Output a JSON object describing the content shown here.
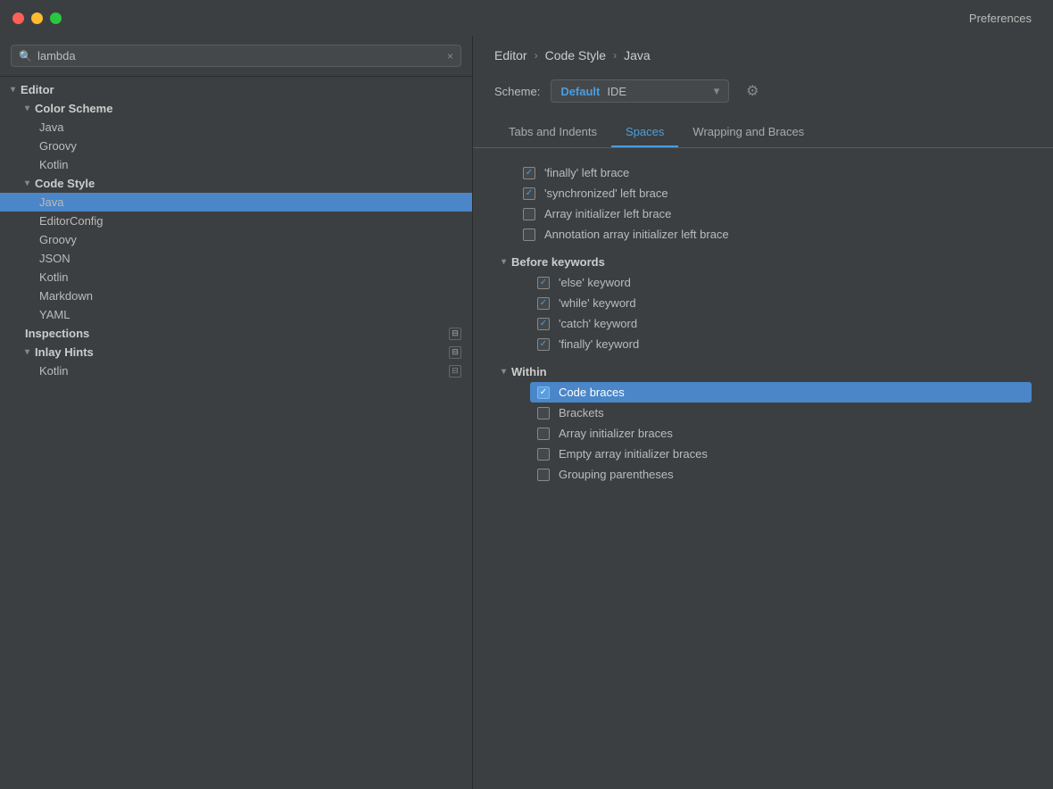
{
  "window": {
    "title": "Preferences"
  },
  "titleBar": {
    "close": "close",
    "minimize": "minimize",
    "maximize": "maximize"
  },
  "sidebar": {
    "searchPlaceholder": "lambda",
    "clearLabel": "×",
    "tree": [
      {
        "id": "editor",
        "label": "Editor",
        "level": 0,
        "chevron": "▾",
        "hasChevron": true,
        "selected": false,
        "badge": false
      },
      {
        "id": "color-scheme",
        "label": "Color Scheme",
        "level": 1,
        "chevron": "▾",
        "hasChevron": true,
        "selected": false,
        "badge": false
      },
      {
        "id": "java-color",
        "label": "Java",
        "level": 2,
        "hasChevron": false,
        "selected": false,
        "badge": false
      },
      {
        "id": "groovy-color",
        "label": "Groovy",
        "level": 2,
        "hasChevron": false,
        "selected": false,
        "badge": false
      },
      {
        "id": "kotlin-color",
        "label": "Kotlin",
        "level": 2,
        "hasChevron": false,
        "selected": false,
        "badge": false
      },
      {
        "id": "code-style",
        "label": "Code Style",
        "level": 1,
        "chevron": "▾",
        "hasChevron": true,
        "selected": false,
        "badge": false
      },
      {
        "id": "java-cs",
        "label": "Java",
        "level": 2,
        "hasChevron": false,
        "selected": true,
        "badge": false
      },
      {
        "id": "editorconfig",
        "label": "EditorConfig",
        "level": 2,
        "hasChevron": false,
        "selected": false,
        "badge": false
      },
      {
        "id": "groovy-cs",
        "label": "Groovy",
        "level": 2,
        "hasChevron": false,
        "selected": false,
        "badge": false
      },
      {
        "id": "json-cs",
        "label": "JSON",
        "level": 2,
        "hasChevron": false,
        "selected": false,
        "badge": false
      },
      {
        "id": "kotlin-cs",
        "label": "Kotlin",
        "level": 2,
        "hasChevron": false,
        "selected": false,
        "badge": false
      },
      {
        "id": "markdown-cs",
        "label": "Markdown",
        "level": 2,
        "hasChevron": false,
        "selected": false,
        "badge": false
      },
      {
        "id": "yaml-cs",
        "label": "YAML",
        "level": 2,
        "hasChevron": false,
        "selected": false,
        "badge": false
      },
      {
        "id": "inspections",
        "label": "Inspections",
        "level": 1,
        "hasChevron": false,
        "selected": false,
        "badge": true
      },
      {
        "id": "inlay-hints",
        "label": "Inlay Hints",
        "level": 1,
        "chevron": "▾",
        "hasChevron": true,
        "selected": false,
        "badge": true
      },
      {
        "id": "kotlin-ih",
        "label": "Kotlin",
        "level": 2,
        "hasChevron": false,
        "selected": false,
        "badge": true
      }
    ]
  },
  "rightPanel": {
    "breadcrumb": {
      "parts": [
        "Editor",
        "Code Style",
        "Java"
      ],
      "separators": [
        "›",
        "›"
      ]
    },
    "scheme": {
      "label": "Scheme:",
      "valueBlue": "Default",
      "valueNormal": " IDE"
    },
    "tabs": [
      {
        "id": "tabs-indents",
        "label": "Tabs and Indents",
        "active": false
      },
      {
        "id": "spaces",
        "label": "Spaces",
        "active": true
      },
      {
        "id": "wrapping-braces",
        "label": "Wrapping and Braces",
        "active": false
      }
    ],
    "sections": [
      {
        "id": "before-left-brace",
        "items": [
          {
            "id": "finally-left",
            "label": "'finally' left brace",
            "checked": true,
            "selected": false
          },
          {
            "id": "synchronized-left",
            "label": "'synchronized' left brace",
            "checked": true,
            "selected": false
          },
          {
            "id": "array-init-left",
            "label": "Array initializer left brace",
            "checked": false,
            "selected": false
          },
          {
            "id": "annotation-array-init-left",
            "label": "Annotation array initializer left brace",
            "checked": false,
            "selected": false
          }
        ]
      },
      {
        "id": "before-keywords",
        "header": "Before keywords",
        "items": [
          {
            "id": "else-kw",
            "label": "'else' keyword",
            "checked": true,
            "selected": false
          },
          {
            "id": "while-kw",
            "label": "'while' keyword",
            "checked": true,
            "selected": false
          },
          {
            "id": "catch-kw",
            "label": "'catch' keyword",
            "checked": true,
            "selected": false
          },
          {
            "id": "finally-kw",
            "label": "'finally' keyword",
            "checked": true,
            "selected": false
          }
        ]
      },
      {
        "id": "within",
        "header": "Within",
        "items": [
          {
            "id": "code-braces",
            "label": "Code braces",
            "checked": true,
            "selected": true
          },
          {
            "id": "brackets",
            "label": "Brackets",
            "checked": false,
            "selected": false
          },
          {
            "id": "array-init-braces",
            "label": "Array initializer braces",
            "checked": false,
            "selected": false
          },
          {
            "id": "empty-array-init",
            "label": "Empty array initializer braces",
            "checked": false,
            "selected": false
          },
          {
            "id": "grouping-parens",
            "label": "Grouping parentheses",
            "checked": false,
            "selected": false
          }
        ]
      }
    ]
  }
}
